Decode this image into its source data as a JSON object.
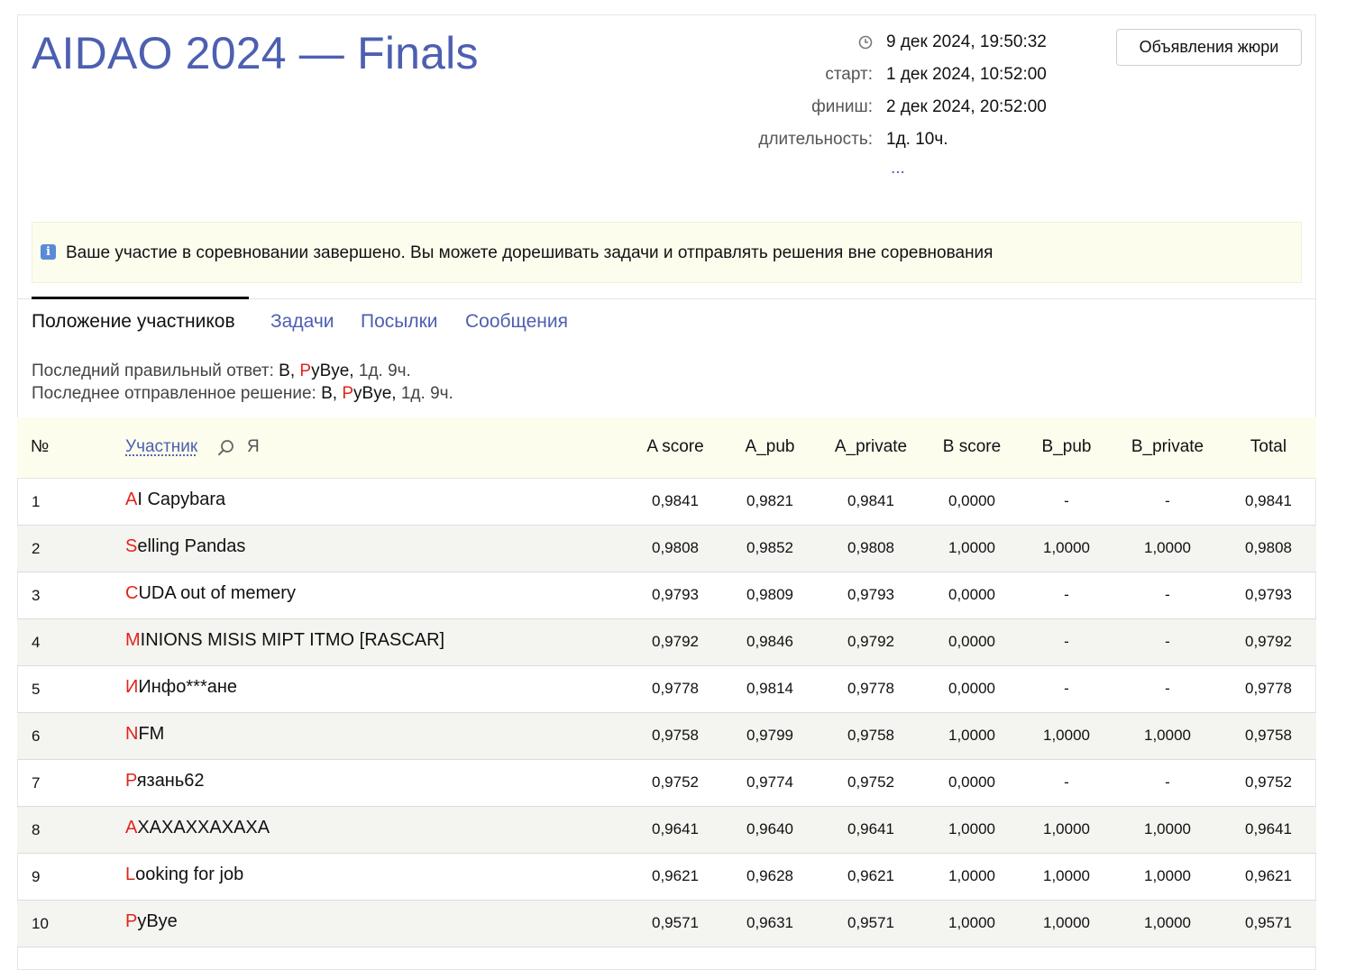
{
  "contest": {
    "title": "AIDAO 2024 — Finals"
  },
  "meta": {
    "now": "9 дек 2024, 19:50:32",
    "start_label": "старт:",
    "start": "1 дек 2024, 10:52:00",
    "finish_label": "финиш:",
    "finish": "2 дек 2024, 20:52:00",
    "duration_label": "длительность:",
    "duration": "1д. 10ч.",
    "more": "..."
  },
  "header": {
    "jury_button": "Объявления жюри"
  },
  "notice": {
    "icon": "info-icon",
    "text": "Ваше участие в соревновании завершено. Вы можете дорешивать задачи и отправлять решения вне соревнования"
  },
  "tabs": [
    {
      "label": "Положение участников",
      "active": true
    },
    {
      "label": "Задачи",
      "active": false
    },
    {
      "label": "Посылки",
      "active": false
    },
    {
      "label": "Сообщения",
      "active": false
    }
  ],
  "last": {
    "correct_label": "Последний правильный ответ:",
    "correct_problem": "B,",
    "correct_team_first": "P",
    "correct_team_rest": "yBye,",
    "correct_time": "1д. 9ч.",
    "sent_label": "Последнее отправленное решение:",
    "sent_problem": "B,",
    "sent_team_first": "P",
    "sent_team_rest": "yBye,",
    "sent_time": "1д. 9ч."
  },
  "table": {
    "columns": {
      "rank": "№",
      "participant": "Участник",
      "me": "Я",
      "a_score": "A score",
      "a_pub": "A_pub",
      "a_private": "A_private",
      "b_score": "B score",
      "b_pub": "B_pub",
      "b_private": "B_private",
      "total": "Total"
    },
    "rows": [
      {
        "rank": "1",
        "first": "A",
        "rest": "I Capybara",
        "a_score": "0,9841",
        "a_pub": "0,9821",
        "a_private": "0,9841",
        "b_score": "0,0000",
        "b_pub": "-",
        "b_private": "-",
        "total": "0,9841"
      },
      {
        "rank": "2",
        "first": "S",
        "rest": "elling Pandas",
        "a_score": "0,9808",
        "a_pub": "0,9852",
        "a_private": "0,9808",
        "b_score": "1,0000",
        "b_pub": "1,0000",
        "b_private": "1,0000",
        "total": "0,9808"
      },
      {
        "rank": "3",
        "first": "C",
        "rest": "UDA out of memery",
        "a_score": "0,9793",
        "a_pub": "0,9809",
        "a_private": "0,9793",
        "b_score": "0,0000",
        "b_pub": "-",
        "b_private": "-",
        "total": "0,9793"
      },
      {
        "rank": "4",
        "first": "M",
        "rest": "INIONS MISIS MIPT ITMO [RASCAR]",
        "a_score": "0,9792",
        "a_pub": "0,9846",
        "a_private": "0,9792",
        "b_score": "0,0000",
        "b_pub": "-",
        "b_private": "-",
        "total": "0,9792"
      },
      {
        "rank": "5",
        "first": "И",
        "rest": "Инфо***ане",
        "a_score": "0,9778",
        "a_pub": "0,9814",
        "a_private": "0,9778",
        "b_score": "0,0000",
        "b_pub": "-",
        "b_private": "-",
        "total": "0,9778"
      },
      {
        "rank": "6",
        "first": "N",
        "rest": "FM",
        "a_score": "0,9758",
        "a_pub": "0,9799",
        "a_private": "0,9758",
        "b_score": "1,0000",
        "b_pub": "1,0000",
        "b_private": "1,0000",
        "total": "0,9758"
      },
      {
        "rank": "7",
        "first": "Р",
        "rest": "язань62",
        "a_score": "0,9752",
        "a_pub": "0,9774",
        "a_private": "0,9752",
        "b_score": "0,0000",
        "b_pub": "-",
        "b_private": "-",
        "total": "0,9752"
      },
      {
        "rank": "8",
        "first": "А",
        "rest": "ХАХАХХАХАХА",
        "a_score": "0,9641",
        "a_pub": "0,9640",
        "a_private": "0,9641",
        "b_score": "1,0000",
        "b_pub": "1,0000",
        "b_private": "1,0000",
        "total": "0,9641"
      },
      {
        "rank": "9",
        "first": "L",
        "rest": "ooking for job",
        "a_score": "0,9621",
        "a_pub": "0,9628",
        "a_private": "0,9621",
        "b_score": "1,0000",
        "b_pub": "1,0000",
        "b_private": "1,0000",
        "total": "0,9621"
      },
      {
        "rank": "10",
        "first": "P",
        "rest": "yBye",
        "a_score": "0,9571",
        "a_pub": "0,9631",
        "a_private": "0,9571",
        "b_score": "1,0000",
        "b_pub": "1,0000",
        "b_private": "1,0000",
        "total": "0,9571"
      }
    ]
  },
  "colors": {
    "title": "#4d5fb0",
    "link": "#4d5fb0",
    "accent_letter": "#e0251b",
    "notice_bg": "#fdfdee"
  }
}
